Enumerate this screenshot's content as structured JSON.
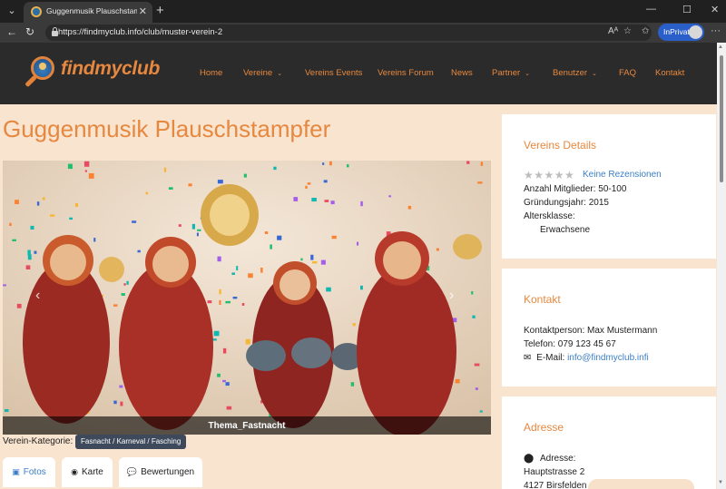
{
  "browser": {
    "tab_title": "Guggenmusik Plauschstampfer - F",
    "url": "https://findmyclub.info/club/muster-verein-2",
    "inprivate_label": "InPrivate"
  },
  "site": {
    "logo_text": "findmyclub",
    "nav": [
      {
        "label": "Home"
      },
      {
        "label": "Vereine"
      },
      {
        "label": "Vereins Events"
      },
      {
        "label": "Vereins Forum"
      },
      {
        "label": "News"
      },
      {
        "label": "Partner"
      },
      {
        "label": "Benutzer"
      },
      {
        "label": "FAQ"
      },
      {
        "label": "Kontakt"
      }
    ]
  },
  "club": {
    "title": "Guggenmusik Plauschstampfer",
    "image_caption": "Thema_Fastnacht",
    "category_label": "Verein-Kategorie:",
    "category_value": "Fasnacht / Karneval / Fasching",
    "tabs": [
      {
        "label": "Fotos"
      },
      {
        "label": "Karte"
      },
      {
        "label": "Bewertungen"
      }
    ]
  },
  "sidebar": {
    "details": {
      "heading": "Vereins Details",
      "reviews_link": "Keine Rezensionen",
      "members": "Anzahl Mitglieder: 50-100",
      "founded": "Gründungsjahr: 2015",
      "age_label": "Altersklasse:",
      "age_value": "Erwachsene"
    },
    "contact": {
      "heading": "Kontakt",
      "person": "Kontaktperson: Max Mustermann",
      "phone": "Telefon: 079 123 45 67",
      "email_label": "E-Mail:",
      "email": "info@findmyclub.infi"
    },
    "address": {
      "heading": "Adresse",
      "label": "Adresse:",
      "street": "Hauptstrasse 2",
      "city": "4127 Birsfelden"
    }
  },
  "colors": {
    "accent": "#e6883f",
    "link": "#3c7fc4",
    "page_bg": "#f9e4cf",
    "header_bg": "#2b2b2b"
  }
}
